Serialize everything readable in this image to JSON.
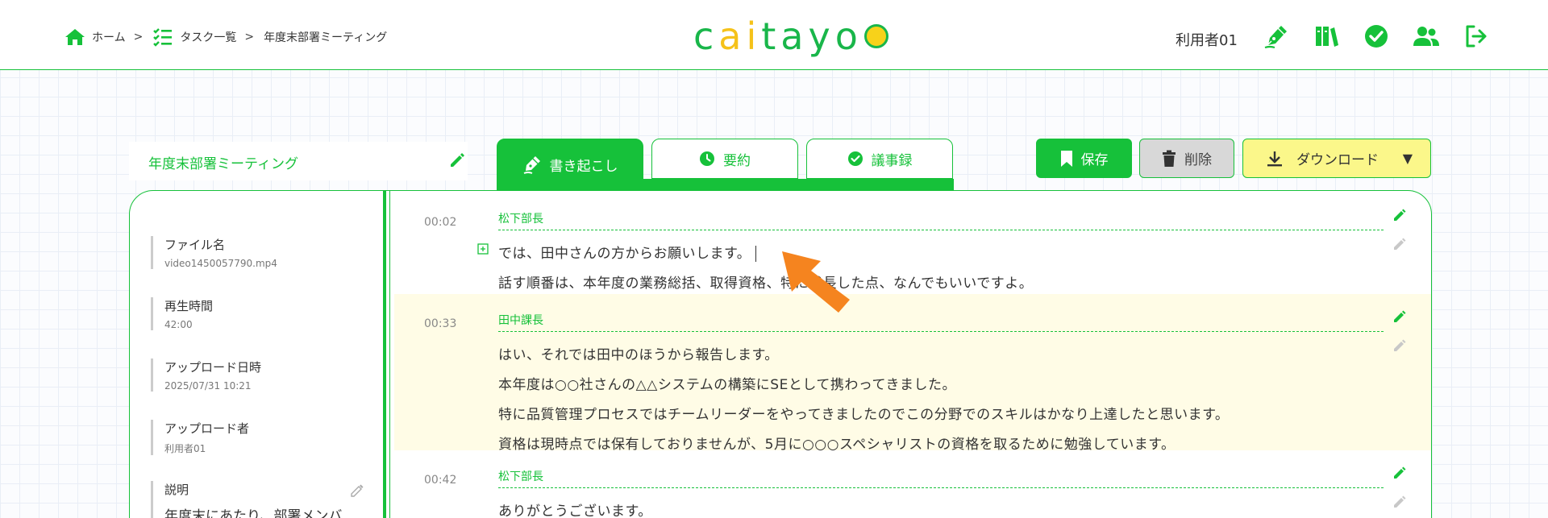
{
  "breadcrumb": {
    "home": "ホーム",
    "tasks": "タスク一覧",
    "current": "年度末部署ミーティング",
    "sep": ">"
  },
  "logo": {
    "a": "c",
    "b": "ai",
    "c": "tayo"
  },
  "header": {
    "user": "利用者01"
  },
  "task": {
    "title": "年度末部署ミーティング"
  },
  "tabs": [
    {
      "label": "書き起こし",
      "icon": "pen-icon",
      "active": true
    },
    {
      "label": "要約",
      "icon": "clock-icon"
    },
    {
      "label": "議事録",
      "icon": "check-circle-icon"
    }
  ],
  "actions": {
    "save": "保存",
    "delete": "削除",
    "download": "ダウンロード",
    "caret": "▼"
  },
  "meta": {
    "file_label": "ファイル名",
    "file_value": "video1450057790.mp4",
    "duration_label": "再生時間",
    "duration_value": "42:00",
    "uploaded_label": "アップロード日時",
    "uploaded_value": "2025/07/31 10:21",
    "uploader_label": "アップロード者",
    "uploader_value": "利用者01",
    "desc_label": "説明",
    "desc_value": "年度末にあたり、部署メンバ"
  },
  "segments": [
    {
      "time": "00:02",
      "speaker": "松下部長",
      "lines": [
        "では、田中さんの方からお願いします。",
        "話す順番は、本年度の業務総括、取得資格、特に成長した点、なんでもいいですよ。"
      ]
    },
    {
      "time": "00:33",
      "speaker": "田中課長",
      "highlighted": true,
      "lines": [
        "はい、それでは田中のほうから報告します。",
        "本年度は○○社さんの△△システムの構築にSEとして携わってきました。",
        "特に品質管理プロセスではチームリーダーをやってきましたのでこの分野でのスキルはかなり上達したと思います。",
        "資格は現時点では保有しておりませんが、5月に○○○スペシャリストの資格を取るために勉強しています。"
      ]
    },
    {
      "time": "00:42",
      "speaker": "松下部長",
      "lines": [
        "ありがとうございます。"
      ]
    }
  ],
  "colors": {
    "brand": "#16c13a",
    "highlight": "#fffce6",
    "download": "#fbf78a",
    "cursor": "#f5841f"
  }
}
